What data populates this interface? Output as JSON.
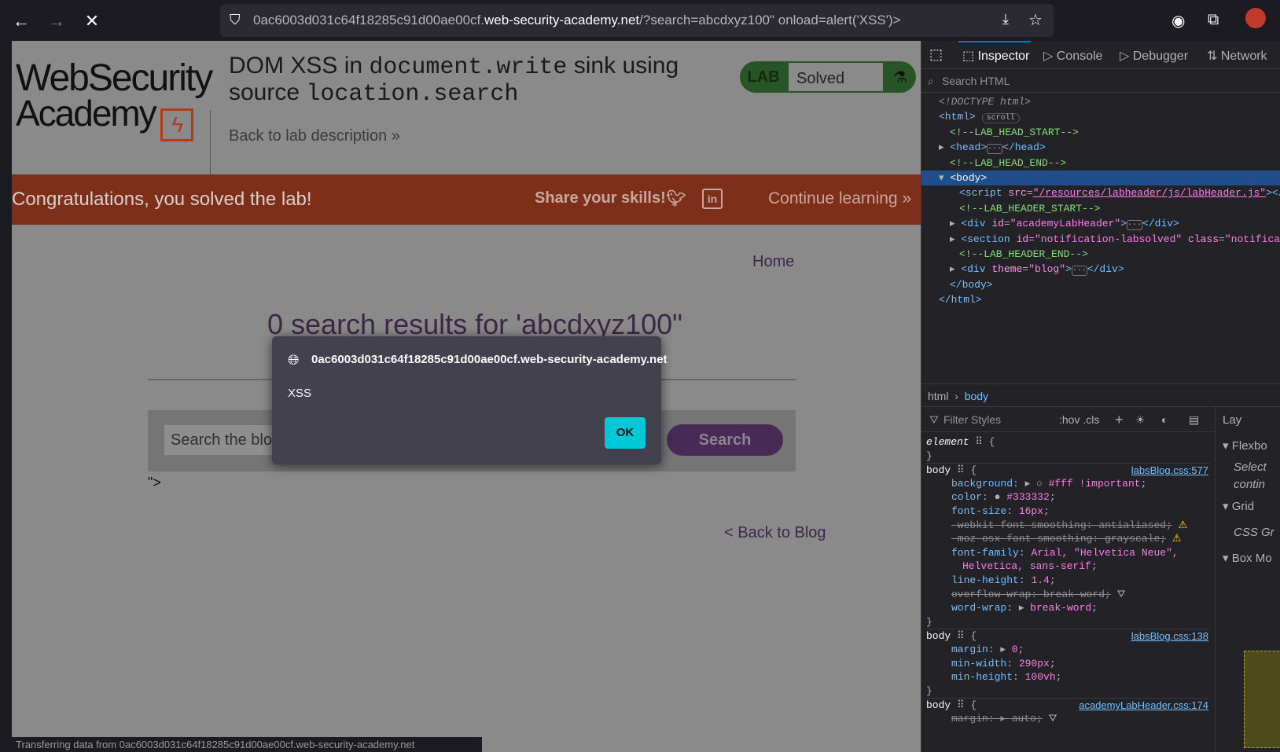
{
  "browser": {
    "url_prefix": "0ac6003d031c64f18285c91d00ae00cf.",
    "url_domain": "web-security-academy.net",
    "url_rest": "/?search=abcdxyz100\" onload=alert('XSS')>",
    "status_text": "Transferring data from 0ac6003d031c64f18285c91d00ae00cf.web-security-academy.net"
  },
  "lab_header": {
    "logo_line1": "WebSecurity",
    "logo_line2": "Academy",
    "title_part1": "DOM XSS in ",
    "title_code1": "document.write",
    "title_part2": " sink using",
    "title_part3": "source ",
    "title_code2": "location.search",
    "back_link": "Back to lab description",
    "badge_lab": "LAB",
    "badge_status": "Solved"
  },
  "banner": {
    "message": "Congratulations, you solved the lab!",
    "share": "Share your skills!",
    "continue": "Continue learning"
  },
  "blog": {
    "home": "Home",
    "results_heading": "0 search results for 'abcdxyz100\"",
    "search_placeholder": "Search the blog...",
    "search_button": "Search",
    "stray_text": "\">",
    "back_link": "< Back to Blog"
  },
  "dialog": {
    "origin": "0ac6003d031c64f18285c91d00ae00cf.web-security-academy.net",
    "message": "XSS",
    "ok": "OK"
  },
  "devtools": {
    "tabs": [
      "Inspector",
      "Console",
      "Debugger",
      "Network"
    ],
    "search_placeholder": "Search HTML",
    "breadcrumb": [
      "html",
      "body"
    ],
    "filter_placeholder": "Filter Styles",
    "filter_tools": ":hov  .cls",
    "layout_items": [
      "Lay",
      "Flexbo",
      "Select",
      "contin",
      "Grid",
      "CSS Gr",
      "Box Mo"
    ]
  }
}
